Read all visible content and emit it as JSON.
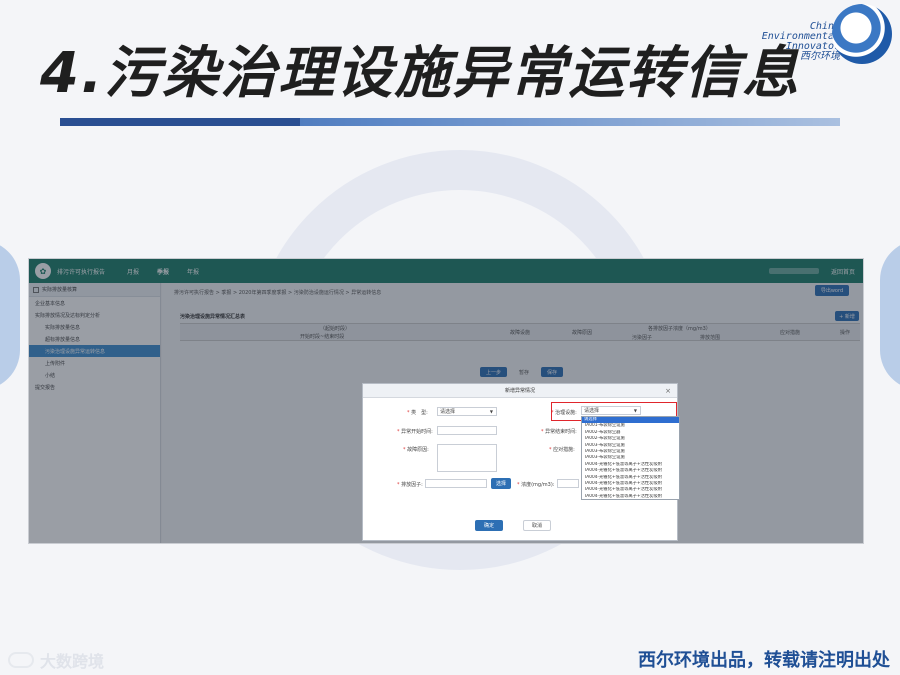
{
  "slide": {
    "title": "4.污染治理设施异常运转信息",
    "logo_text": [
      "China",
      "Environmental",
      "Innovator",
      "西尔环境"
    ],
    "footer_left": "大数跨境",
    "footer_right": "西尔环境出品，转载请注明出处"
  },
  "app": {
    "system_name": "排污许可执行报告",
    "nav": [
      "月报",
      "季报",
      "年报"
    ],
    "back_label": "返回首页",
    "sidebar": {
      "header": "实际排放量核算",
      "items": [
        {
          "label": "企业基本信息",
          "sub": false,
          "active": false
        },
        {
          "label": "实际排放情况及达标判定分析",
          "sub": false,
          "active": false
        },
        {
          "label": "实际排放量信息",
          "sub": true,
          "active": false
        },
        {
          "label": "超标排放量信息",
          "sub": true,
          "active": false
        },
        {
          "label": "污染治理设施异常运转信息",
          "sub": true,
          "active": true
        },
        {
          "label": "上传附件",
          "sub": true,
          "active": false
        },
        {
          "label": "小结",
          "sub": true,
          "active": false
        },
        {
          "label": "提交报告",
          "sub": false,
          "active": false
        }
      ]
    },
    "breadcrumb": "排污许可执行报告 > 季报 > 2020年第四季度季报 > 污染防治设施运行情况 > 异常运转信息",
    "export_label": "导出word",
    "table_title": "污染治理设施异常情况汇总表",
    "add_label": "+ 新增",
    "table_headers": {
      "period": "（起始时段）",
      "start_end": "开始时段~结束时段",
      "fault_facility": "故障设施",
      "fault_reason": "故障原因",
      "conc_group": "各排放因子浓度（mg/m3）",
      "pollutant": "污染因子",
      "range": "排放范围",
      "measures": "应对措施",
      "ops": "操作"
    },
    "pager": {
      "prev": "上一步",
      "save": "暂存",
      "next": "保存"
    }
  },
  "modal": {
    "title": "新增异常情况",
    "close": "×",
    "fields": {
      "type_label": "类　型:",
      "type_value": "请选择",
      "facility_label": "治理设施:",
      "facility_value": "请选择",
      "start_label": "异常开始时间:",
      "end_label": "异常结束时间:",
      "reason_label": "故障原因:",
      "measures_label": "应对措施:",
      "pollutant_label": "排放因子:",
      "choose_label": "选择",
      "conc_label": "浓度(mg/m3):"
    },
    "dropdown_options": [
      {
        "label": "请选择",
        "selected": true
      },
      {
        "label": "TA001-布袋除尘设施",
        "selected": false
      },
      {
        "label": "TA002-布袋除尘器",
        "selected": false
      },
      {
        "label": "TA002-布袋除尘设施",
        "selected": false
      },
      {
        "label": "TA003-布袋除尘设施",
        "selected": false
      },
      {
        "label": "TA003-布袋除尘设施",
        "selected": false
      },
      {
        "label": "TA003-布袋除尘设施",
        "selected": false
      },
      {
        "label": "TA004-光催化+低温等离子+活性炭吸附",
        "selected": false
      },
      {
        "label": "TA004-光催化+低温等离子+活性炭吸附",
        "selected": false
      },
      {
        "label": "TA004-光催化+低温等离子+活性炭吸附",
        "selected": false
      },
      {
        "label": "TA004-光催化+低温等离子+活性炭吸附",
        "selected": false
      },
      {
        "label": "TA004-光催化+低温等离子+活性炭吸附",
        "selected": false
      },
      {
        "label": "TA004-光催化+低温等离子+活性炭吸附",
        "selected": false
      }
    ],
    "ok_label": "确定",
    "cancel_label": "取消"
  },
  "colors": {
    "accent": "#2d6fb4",
    "header_green": "#1e7f6b",
    "highlight_red": "#e0262c",
    "title_blue": "#1f4f95"
  }
}
